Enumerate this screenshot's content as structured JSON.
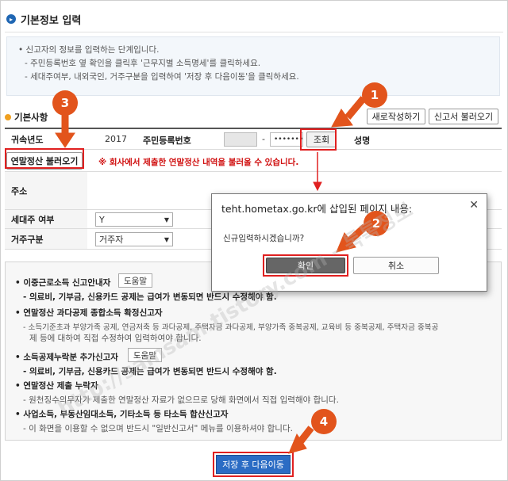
{
  "header": {
    "title": "기본정보 입력"
  },
  "intro": {
    "lines": [
      "• 신고자의 정보를 입력하는 단계입니다.",
      "- 주민등록번호 옆 확인을 클릭후 '근무지별 소득명세'를 클릭하세요.",
      "- 세대주여부, 내외국인, 거주구분을 입력하여 '저장 후 다음이동'을 클릭하세요."
    ]
  },
  "section": {
    "label": "기본사항"
  },
  "toolbar": {
    "new_label": "새로작성하기",
    "load_label": "신고서 불러오기"
  },
  "form": {
    "year_label": "귀속년도",
    "year_value": "2017",
    "rrn_label": "주민등록번호",
    "rrn_dash": "-",
    "rrn_back": "•••••••",
    "check_label": "조회",
    "name_label": "성명",
    "load_settlement_label": "연말정산 불러오기",
    "load_notice": "※ 회사에서 제출한 연말정산 내역을 불러올 수 있습니다.",
    "address_label": "주소",
    "householder_label": "세대주 여부",
    "householder_value": "Y",
    "residence_label": "거주구분",
    "residence_value": "거주자"
  },
  "dialog": {
    "title": "teht.hometax.go.kr에 삽입된 페이지 내용:",
    "close": "✕",
    "message": "신규입력하시겠습니까?",
    "ok_label": "확인",
    "cancel_label": "취소"
  },
  "guide": {
    "item1_title": "• 이중근로소득 신고안내자",
    "item1_btn": "도움말",
    "item1_sub": "- 의료비, 기부금, 신용카드 공제는 급여가 변동되면 반드시 수정해야 함.",
    "item2_title": "• 연말정산 과다공제 종합소득 확정신고자",
    "item2_sub1": "- 소득기준초과 부양가족 공제, 연금저축 등 과다공제, 주택자금 과다공제, 부양가족 중복공제, 교육비 등 중복공제, 주택자금 중복공",
    "item2_sub2": "제 등에 대하여 직접 수정하여 입력하여야 합니다.",
    "item3_title": "• 소득공제누락분 추가신고자",
    "item3_btn": "도움말",
    "item3_sub": "- 의료비, 기부금, 신용카드 공제는 급여가 변동되면 반드시 수정해야 함.",
    "item4_title": "• 연말정산 제출 누락자",
    "item4_sub": "- 원천징수의무자가 제출한 연말정산 자료가 없으므로 당해 화면에서 직접 입력해야 합니다.",
    "item5_title": "• 사업소득, 부동산임대소득, 기타소득 등 타소득 합산신고자",
    "item5_sub": "- 이 화면을 이용할 수 없으며 반드시 \"일반신고서\" 메뉴를 이용하셔야 합니다."
  },
  "footer": {
    "save_label": "저장 후 다음이동"
  },
  "callouts": {
    "c1": "1",
    "c2": "2",
    "c3": "3",
    "c4": "4"
  },
  "watermark": {
    "text": "http://samsam.tistory.com - 톡톡정보"
  },
  "colors": {
    "accent": "#2b6cc4",
    "callout": "#e2541c",
    "highlight": "#e02020"
  }
}
